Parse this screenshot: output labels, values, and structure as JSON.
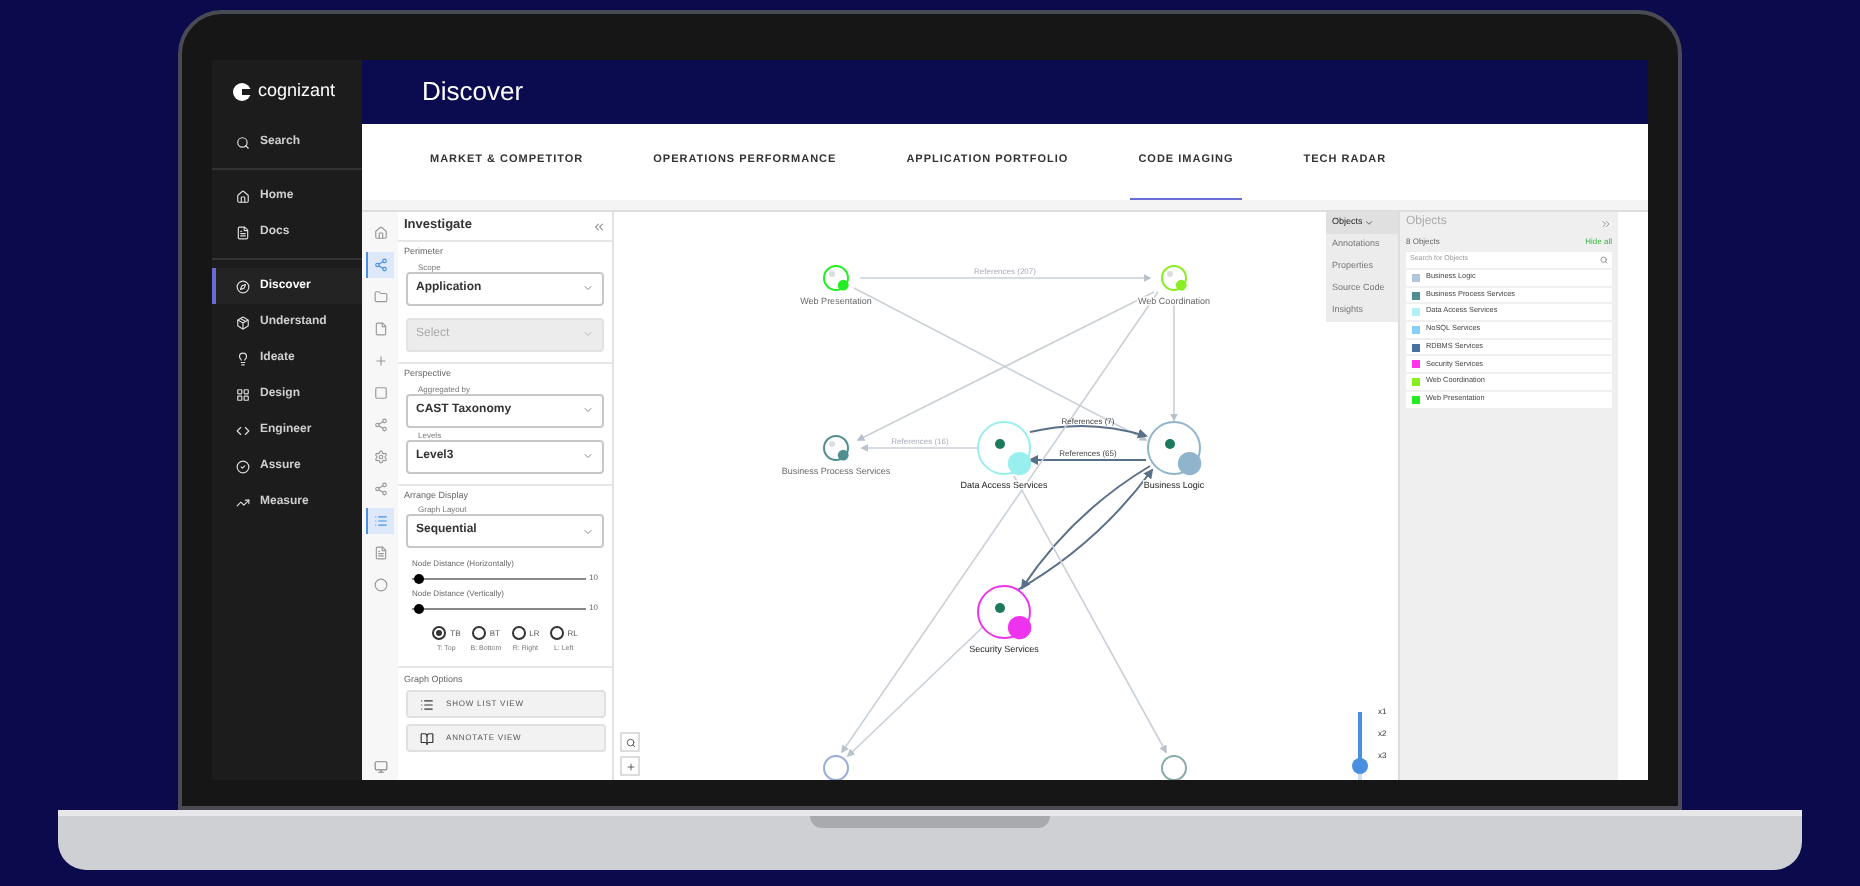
{
  "sidebar": {
    "logo": "cognizant",
    "items": [
      {
        "label": "Search",
        "selected": false
      },
      {
        "label": "Home",
        "selected": false
      },
      {
        "label": "Docs",
        "selected": false
      },
      {
        "label": "Discover",
        "selected": true
      },
      {
        "label": "Understand",
        "selected": false
      },
      {
        "label": "Ideate",
        "selected": false
      },
      {
        "label": "Design",
        "selected": false
      },
      {
        "label": "Engineer",
        "selected": false
      },
      {
        "label": "Assure",
        "selected": false
      },
      {
        "label": "Measure",
        "selected": false
      }
    ]
  },
  "header": {
    "title": "Discover"
  },
  "tabs": [
    {
      "label": "MARKET & COMPETITOR",
      "selected": false
    },
    {
      "label": "OPERATIONS PERFORMANCE",
      "selected": false
    },
    {
      "label": "APPLICATION PORTFOLIO",
      "selected": false
    },
    {
      "label": "CODE IMAGING",
      "selected": true
    },
    {
      "label": "TECH RADAR",
      "selected": false
    }
  ],
  "rail_icons": [
    {
      "selected": false
    },
    {
      "selected": true
    },
    {
      "selected": false
    },
    {
      "selected": false
    },
    {
      "selected": false
    },
    {
      "selected": false
    },
    {
      "selected": false
    },
    {
      "selected": false
    },
    {
      "selected": false
    },
    {
      "selected": true
    },
    {
      "selected": false
    },
    {
      "selected": false
    }
  ],
  "panel": {
    "title": "Investigate",
    "sections": [
      {
        "title": "Perimeter",
        "fields": [
          {
            "label": "Scope",
            "value": "Application",
            "disabled": false
          },
          {
            "placeholder": "Select",
            "disabled": true
          }
        ]
      },
      {
        "title": "Perspective",
        "fields": [
          {
            "label": "Aggregated by",
            "value": "CAST Taxonomy",
            "disabled": false
          },
          {
            "label": "Levels",
            "value": "Level3",
            "disabled": false
          }
        ]
      },
      {
        "title": "Arrange Display",
        "fields": [
          {
            "label": "Graph Layout",
            "value": "Sequential",
            "disabled": false
          }
        ]
      }
    ],
    "sliders": [
      {
        "label": "Node Distance (Horizontally)",
        "level": 0.04,
        "reading": "10"
      },
      {
        "label": "Node Distance (Vertically)",
        "level": 0.04,
        "reading": "10"
      }
    ],
    "directions": [
      {
        "label": "TB",
        "caption": "T: Top",
        "selected": true
      },
      {
        "label": "BT",
        "caption": "B: Bottom",
        "selected": false
      },
      {
        "label": "LR",
        "caption": "R: Right",
        "selected": false
      },
      {
        "label": "RL",
        "caption": "L: Left",
        "selected": false
      }
    ],
    "options_title": "Graph Options",
    "options": [
      "SHOW LIST VIEW",
      "ANNOTATE VIEW"
    ]
  },
  "graph": {
    "nodes": [
      {
        "label": "Web Presentation",
        "color": "#22ee22",
        "faded": true
      },
      {
        "label": "Web Coordination",
        "color": "#88ee22",
        "faded": true
      },
      {
        "label": "Business Process Services",
        "color": "#4f8f8f",
        "faded": true
      },
      {
        "label": "Data Access Services",
        "color": "#99eeee",
        "faded": false
      },
      {
        "label": "Business Logic",
        "color": "#8fb4cc",
        "faded": false
      },
      {
        "label": "Security Services",
        "color": "#ee33ee",
        "faded": false
      }
    ],
    "edge_labels": [
      "References (207)",
      "References (16)",
      "References (7)",
      "References (65)"
    ],
    "zoom_levels": [
      "x1",
      "x2",
      "x3"
    ],
    "zoom": {
      "level": 0.67
    }
  },
  "side_tabs": [
    {
      "label": "Objects",
      "selected": true
    },
    {
      "label": "Annotations",
      "selected": false
    },
    {
      "label": "Properties",
      "selected": false
    },
    {
      "label": "Source Code",
      "selected": false
    },
    {
      "label": "Insights",
      "selected": false
    }
  ],
  "objects": {
    "title": "Objects",
    "count": "8 Objects",
    "action": "Hide all",
    "search": {
      "placeholder": "Search for Objects"
    },
    "items": [
      {
        "label": "Business Logic",
        "color": "#b0c4de"
      },
      {
        "label": "Business Process Services",
        "color": "#4f8f8f"
      },
      {
        "label": "Data Access Services",
        "color": "#b0f0f0"
      },
      {
        "label": "NoSQL Services",
        "color": "#87cefa"
      },
      {
        "label": "RDBMS Services",
        "color": "#4670a0"
      },
      {
        "label": "Security Services",
        "color": "#ff33ee"
      },
      {
        "label": "Web Coordination",
        "color": "#88ee22"
      },
      {
        "label": "Web Presentation",
        "color": "#22ee22"
      }
    ]
  }
}
